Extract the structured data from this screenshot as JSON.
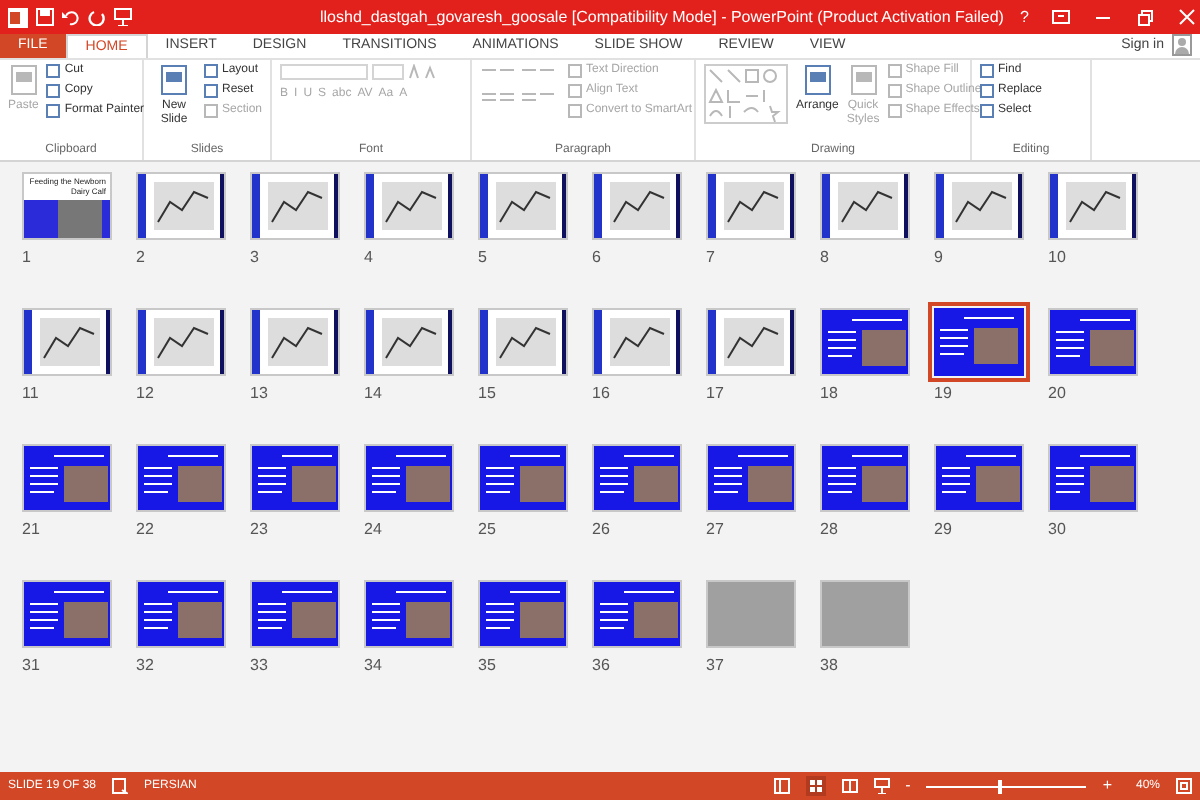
{
  "window": {
    "title": "lloshd_dastgah_govaresh_goosale [Compatibility Mode] - PowerPoint (Product Activation Failed)",
    "help": "?"
  },
  "tabs": [
    {
      "label": "FILE",
      "kind": "file",
      "selected": false
    },
    {
      "label": "HOME",
      "kind": "tab",
      "selected": true
    },
    {
      "label": "INSERT",
      "kind": "tab",
      "selected": false
    },
    {
      "label": "DESIGN",
      "kind": "tab",
      "selected": false
    },
    {
      "label": "TRANSITIONS",
      "kind": "tab",
      "selected": false
    },
    {
      "label": "ANIMATIONS",
      "kind": "tab",
      "selected": false
    },
    {
      "label": "SLIDE SHOW",
      "kind": "tab",
      "selected": false
    },
    {
      "label": "REVIEW",
      "kind": "tab",
      "selected": false
    },
    {
      "label": "VIEW",
      "kind": "tab",
      "selected": false
    }
  ],
  "sign_in": "Sign in",
  "ribbon": {
    "groups": [
      {
        "label": "Clipboard",
        "items": [
          {
            "kind": "large",
            "label": "Paste",
            "disabled": true
          },
          {
            "kind": "small",
            "label": "Cut",
            "disabled": false
          },
          {
            "kind": "small",
            "label": "Copy",
            "disabled": false
          },
          {
            "kind": "small",
            "label": "Format Painter",
            "disabled": false
          }
        ]
      },
      {
        "label": "Slides",
        "items": [
          {
            "kind": "large",
            "label": "New Slide",
            "disabled": false
          },
          {
            "kind": "small",
            "label": "Layout",
            "disabled": false
          },
          {
            "kind": "small",
            "label": "Reset",
            "disabled": false
          },
          {
            "kind": "small",
            "label": "Section",
            "disabled": true
          }
        ]
      },
      {
        "label": "Font",
        "items": [
          {
            "kind": "font",
            "disabled": true
          }
        ],
        "format_buttons": [
          "B",
          "I",
          "U",
          "S",
          "abc",
          "AV",
          "Aa",
          "A"
        ]
      },
      {
        "label": "Paragraph",
        "items": [
          {
            "kind": "paragraph",
            "disabled": true
          },
          {
            "kind": "small",
            "label": "Text Direction",
            "disabled": true
          },
          {
            "kind": "small",
            "label": "Align Text",
            "disabled": true
          },
          {
            "kind": "small",
            "label": "Convert to SmartArt",
            "disabled": true
          }
        ]
      },
      {
        "label": "Drawing",
        "items": [
          {
            "kind": "shapes",
            "disabled": true
          },
          {
            "kind": "large",
            "label": "Arrange",
            "disabled": false
          },
          {
            "kind": "large",
            "label": "Quick Styles",
            "disabled": true
          },
          {
            "kind": "small",
            "label": "Shape Fill",
            "disabled": true
          },
          {
            "kind": "small",
            "label": "Shape Outline",
            "disabled": true
          },
          {
            "kind": "small",
            "label": "Shape Effects",
            "disabled": true
          }
        ]
      },
      {
        "label": "Editing",
        "items": [
          {
            "kind": "small",
            "label": "Find",
            "disabled": false
          },
          {
            "kind": "small",
            "label": "Replace",
            "disabled": false
          },
          {
            "kind": "small",
            "label": "Select",
            "disabled": false
          }
        ]
      }
    ]
  },
  "slides": [
    {
      "number": "1",
      "kind": "title",
      "title": "Feeding the Newborn Dairy Calf",
      "selected": false
    },
    {
      "number": "2",
      "kind": "figure",
      "selected": false
    },
    {
      "number": "3",
      "kind": "figure",
      "selected": false
    },
    {
      "number": "4",
      "kind": "figure",
      "selected": false
    },
    {
      "number": "5",
      "kind": "figure",
      "selected": false
    },
    {
      "number": "6",
      "kind": "figure",
      "selected": false
    },
    {
      "number": "7",
      "kind": "figure",
      "selected": false
    },
    {
      "number": "8",
      "kind": "figure",
      "selected": false
    },
    {
      "number": "9",
      "kind": "figure",
      "selected": false
    },
    {
      "number": "10",
      "kind": "figure",
      "selected": false
    },
    {
      "number": "11",
      "kind": "figure",
      "selected": false
    },
    {
      "number": "12",
      "kind": "figure",
      "selected": false
    },
    {
      "number": "13",
      "kind": "figure",
      "selected": false
    },
    {
      "number": "14",
      "kind": "figure",
      "selected": false
    },
    {
      "number": "15",
      "kind": "figure",
      "selected": false
    },
    {
      "number": "16",
      "kind": "figure",
      "selected": false
    },
    {
      "number": "17",
      "kind": "figure",
      "selected": false
    },
    {
      "number": "18",
      "kind": "blue",
      "selected": false
    },
    {
      "number": "19",
      "kind": "blue",
      "selected": true
    },
    {
      "number": "20",
      "kind": "blue",
      "selected": false
    },
    {
      "number": "21",
      "kind": "blue",
      "selected": false
    },
    {
      "number": "22",
      "kind": "blue",
      "selected": false
    },
    {
      "number": "23",
      "kind": "blue",
      "selected": false
    },
    {
      "number": "24",
      "kind": "blue",
      "selected": false
    },
    {
      "number": "25",
      "kind": "blue",
      "selected": false
    },
    {
      "number": "26",
      "kind": "blue",
      "selected": false
    },
    {
      "number": "27",
      "kind": "blue",
      "selected": false
    },
    {
      "number": "28",
      "kind": "blue",
      "selected": false
    },
    {
      "number": "29",
      "kind": "blue",
      "selected": false
    },
    {
      "number": "30",
      "kind": "blue",
      "selected": false
    },
    {
      "number": "31",
      "kind": "blue",
      "selected": false
    },
    {
      "number": "32",
      "kind": "blue",
      "selected": false
    },
    {
      "number": "33",
      "kind": "blue",
      "selected": false
    },
    {
      "number": "34",
      "kind": "blue",
      "selected": false
    },
    {
      "number": "35",
      "kind": "blue",
      "selected": false
    },
    {
      "number": "36",
      "kind": "blue",
      "selected": false
    },
    {
      "number": "37",
      "kind": "photo",
      "selected": false
    },
    {
      "number": "38",
      "kind": "photo",
      "selected": false
    }
  ],
  "status_bar": {
    "slide": "SLIDE 19 OF 38",
    "language": "PERSIAN",
    "zoom": {
      "level": 0.45
    },
    "zoom_reading": "40%",
    "zoom_out": "-",
    "zoom_in": "+"
  }
}
